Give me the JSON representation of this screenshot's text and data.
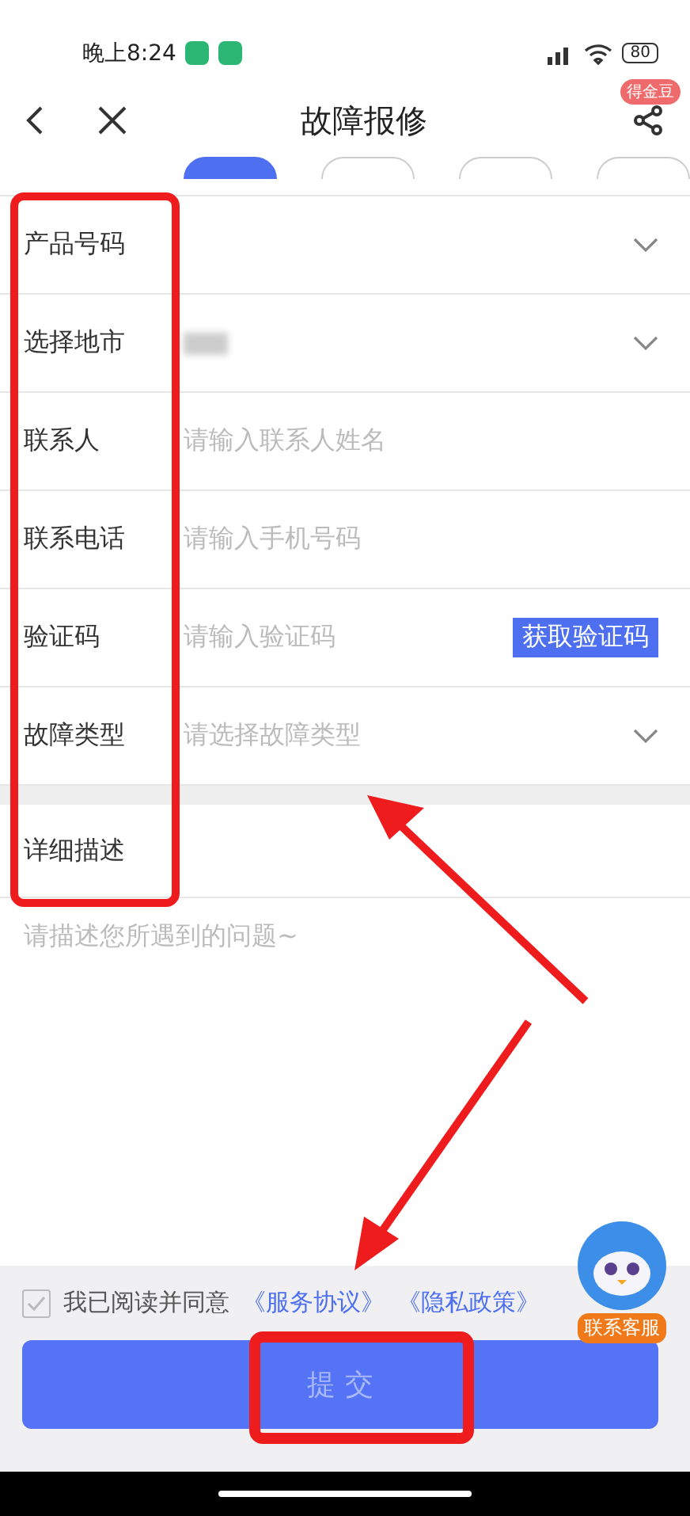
{
  "status_bar": {
    "time": "晚上8:24",
    "battery": "80"
  },
  "header": {
    "title": "故障报修",
    "badge": "得金豆"
  },
  "category_tabs": [
    {
      "selected": true
    },
    {
      "selected": false
    },
    {
      "selected": false
    },
    {
      "selected": false
    }
  ],
  "form_rows": [
    {
      "kind": "select",
      "label": "产品号码",
      "redacted": false
    },
    {
      "kind": "select",
      "label": "选择地市",
      "redacted": true
    },
    {
      "kind": "input",
      "label": "联系人",
      "placeholder": "请输入联系人姓名",
      "redacted": false
    },
    {
      "kind": "input",
      "label": "联系电话",
      "placeholder": "请输入手机号码",
      "redacted": false
    },
    {
      "kind": "code",
      "label": "验证码",
      "placeholder": "请输入验证码",
      "button": "获取验证码",
      "redacted": false
    },
    {
      "kind": "select",
      "label": "故障类型",
      "placeholder": "请选择故障类型",
      "redacted": false
    }
  ],
  "description": {
    "label": "详细描述",
    "placeholder": "请描述您所遇到的问题~"
  },
  "support": {
    "label": "联系客服"
  },
  "agreement": {
    "checked": false,
    "text": "我已阅读并同意",
    "links": [
      "《服务协议》",
      "《隐私政策》"
    ]
  },
  "submit": {
    "label": "提 交"
  }
}
